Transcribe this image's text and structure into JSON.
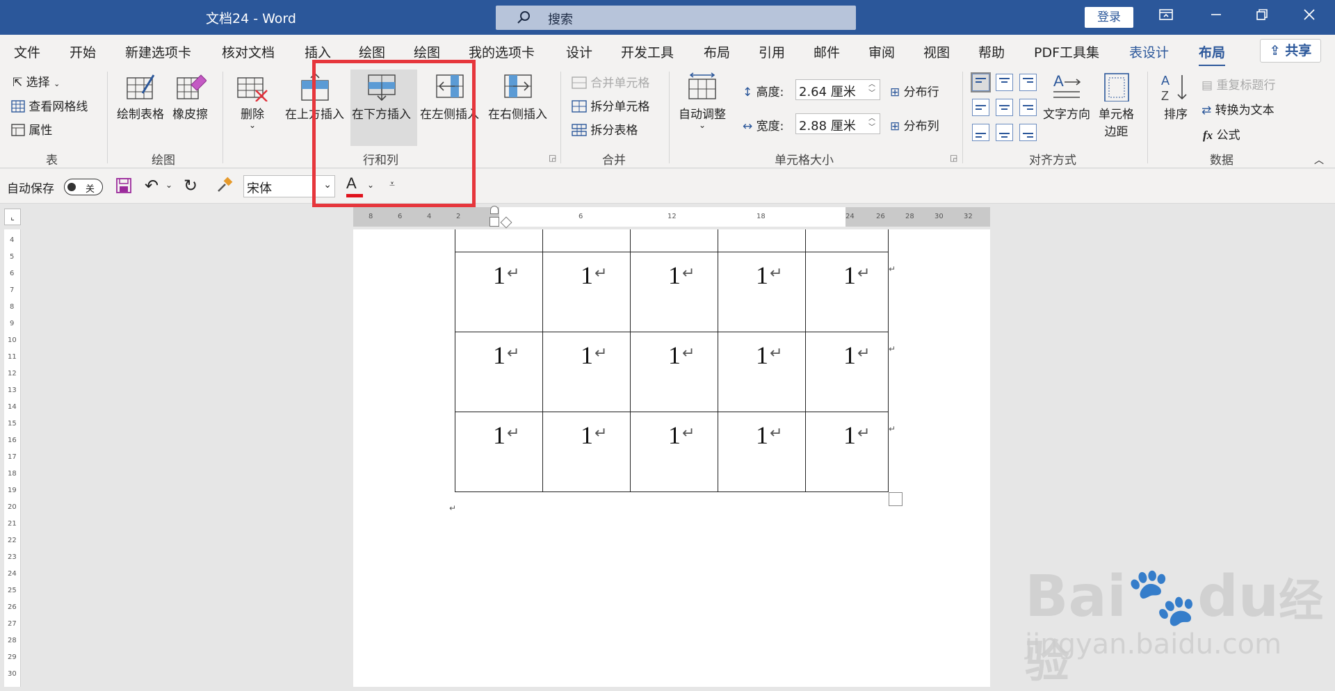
{
  "titlebar": {
    "title": "文档24  -  Word",
    "search_placeholder": "搜索",
    "login": "登录",
    "icons": [
      "ribbon-display-icon",
      "minimize-icon",
      "restore-icon",
      "close-icon"
    ]
  },
  "tabs": [
    "文件",
    "开始",
    "新建选项卡",
    "核对文档",
    "插入",
    "绘图",
    "绘图",
    "我的选项卡",
    "设计",
    "开发工具",
    "布局",
    "引用",
    "邮件",
    "审阅",
    "视图",
    "帮助",
    "PDF工具集"
  ],
  "context_tabs": [
    "表设计",
    "布局"
  ],
  "share_label": "共享",
  "ribbon": {
    "table_group": {
      "select": "选择",
      "gridlines": "查看网格线",
      "properties": "属性",
      "label": "表"
    },
    "draw_group": {
      "draw_table": "绘制表格",
      "eraser": "橡皮擦",
      "label": "绘图"
    },
    "delete": "删除",
    "rows_cols": {
      "insert_above": "在上方插入",
      "insert_below": "在下方插入",
      "insert_left": "在左侧插入",
      "insert_right": "在右侧插入",
      "label": "行和列"
    },
    "merge": {
      "merge_cells": "合并单元格",
      "split_cells": "拆分单元格",
      "split_table": "拆分表格",
      "label": "合并"
    },
    "cell_size": {
      "autofit": "自动调整",
      "height_label": "高度:",
      "height_value": "2.64 厘米",
      "width_label": "宽度:",
      "width_value": "2.88 厘米",
      "distribute_rows": "分布行",
      "distribute_cols": "分布列",
      "label": "单元格大小"
    },
    "alignment": {
      "text_direction": "文字方向",
      "cell_margins_1": "单元格",
      "cell_margins_2": "边距",
      "label": "对齐方式"
    },
    "data": {
      "sort": "排序",
      "repeat_header": "重复标题行",
      "convert_text": "转换为文本",
      "formula": "公式",
      "label": "数据"
    }
  },
  "qat": {
    "autosave": "自动保存",
    "toggle": "关",
    "font": "宋体",
    "font_color_letter": "A"
  },
  "ruler": {
    "h_labels": [
      "8",
      "6",
      "4",
      "2",
      "6",
      "12",
      "18",
      "24",
      "26",
      "28",
      "30",
      "32"
    ],
    "v_labels": [
      "4",
      "5",
      "6",
      "7",
      "8",
      "9",
      "10",
      "11",
      "12",
      "13",
      "14",
      "15",
      "16",
      "17",
      "18",
      "19",
      "20",
      "21",
      "22",
      "23",
      "24",
      "25",
      "26",
      "27",
      "28",
      "29",
      "30"
    ]
  },
  "table": {
    "cell_value": "1",
    "rows": 3,
    "cols": 5
  },
  "watermark": {
    "brand": "Bai",
    "brand2": "du",
    "cn": "经验",
    "url": "jingyan.baidu.com"
  },
  "colors": {
    "accent": "#2b579a",
    "highlight_red": "#e6363c",
    "ribbon_bg": "#f3f2f1"
  }
}
